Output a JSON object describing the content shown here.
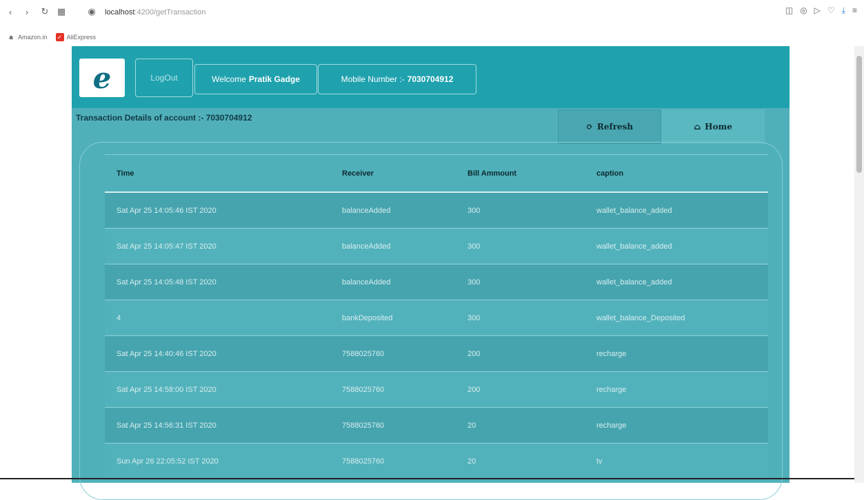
{
  "browser": {
    "host": "localhost",
    "path": ":4200/getTransaction",
    "bookmarks": [
      "Amazon.in",
      "AliExpress"
    ]
  },
  "header": {
    "logo_letter": "e",
    "logout_label": "LogOut",
    "welcome_prefix": "Welcome",
    "user_name": "Pratik Gadge",
    "mobile_prefix": "Mobile Number :-",
    "mobile_number": "7030704912"
  },
  "subheader": {
    "title": "Transaction Details of account :- 7030704912",
    "refresh_label": "Refresh",
    "home_label": "Home"
  },
  "table": {
    "columns": [
      "Time",
      "Receiver",
      "Bill Ammount",
      "caption"
    ],
    "rows": [
      [
        "Sat Apr 25 14:05:46 IST 2020",
        "balanceAdded",
        "300",
        "wallet_balance_added"
      ],
      [
        "Sat Apr 25 14:05:47 IST 2020",
        "balanceAdded",
        "300",
        "wallet_balance_added"
      ],
      [
        "Sat Apr 25 14:05:48 IST 2020",
        "balanceAdded",
        "300",
        "wallet_balance_added"
      ],
      [
        "4",
        "bankDeposited",
        "300",
        "wallet_balance_Deposited"
      ],
      [
        "Sat Apr 25 14:40:46 IST 2020",
        "7588025760",
        "200",
        "recharge"
      ],
      [
        "Sat Apr 25 14:58:00 IST 2020",
        "7588025760",
        "200",
        "recharge"
      ],
      [
        "Sat Apr 25 14:56:31 IST 2020",
        "7588025760",
        "20",
        "recharge"
      ],
      [
        "Sun Apr 26 22:05:52 IST 2020",
        "7588025760",
        "20",
        "tv"
      ]
    ]
  },
  "colors": {
    "header": "#1fa2ae",
    "body": "#4fb0ba",
    "row_dark": "#46a4ae",
    "row_light": "#52b2bb"
  }
}
